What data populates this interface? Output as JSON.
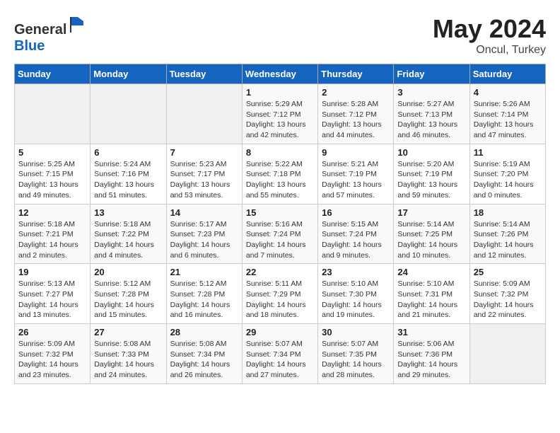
{
  "header": {
    "logo_general": "General",
    "logo_blue": "Blue",
    "month_year": "May 2024",
    "location": "Oncul, Turkey"
  },
  "weekdays": [
    "Sunday",
    "Monday",
    "Tuesday",
    "Wednesday",
    "Thursday",
    "Friday",
    "Saturday"
  ],
  "weeks": [
    [
      {
        "day": "",
        "info": ""
      },
      {
        "day": "",
        "info": ""
      },
      {
        "day": "",
        "info": ""
      },
      {
        "day": "1",
        "info": "Sunrise: 5:29 AM\nSunset: 7:12 PM\nDaylight: 13 hours\nand 42 minutes."
      },
      {
        "day": "2",
        "info": "Sunrise: 5:28 AM\nSunset: 7:12 PM\nDaylight: 13 hours\nand 44 minutes."
      },
      {
        "day": "3",
        "info": "Sunrise: 5:27 AM\nSunset: 7:13 PM\nDaylight: 13 hours\nand 46 minutes."
      },
      {
        "day": "4",
        "info": "Sunrise: 5:26 AM\nSunset: 7:14 PM\nDaylight: 13 hours\nand 47 minutes."
      }
    ],
    [
      {
        "day": "5",
        "info": "Sunrise: 5:25 AM\nSunset: 7:15 PM\nDaylight: 13 hours\nand 49 minutes."
      },
      {
        "day": "6",
        "info": "Sunrise: 5:24 AM\nSunset: 7:16 PM\nDaylight: 13 hours\nand 51 minutes."
      },
      {
        "day": "7",
        "info": "Sunrise: 5:23 AM\nSunset: 7:17 PM\nDaylight: 13 hours\nand 53 minutes."
      },
      {
        "day": "8",
        "info": "Sunrise: 5:22 AM\nSunset: 7:18 PM\nDaylight: 13 hours\nand 55 minutes."
      },
      {
        "day": "9",
        "info": "Sunrise: 5:21 AM\nSunset: 7:19 PM\nDaylight: 13 hours\nand 57 minutes."
      },
      {
        "day": "10",
        "info": "Sunrise: 5:20 AM\nSunset: 7:19 PM\nDaylight: 13 hours\nand 59 minutes."
      },
      {
        "day": "11",
        "info": "Sunrise: 5:19 AM\nSunset: 7:20 PM\nDaylight: 14 hours\nand 0 minutes."
      }
    ],
    [
      {
        "day": "12",
        "info": "Sunrise: 5:18 AM\nSunset: 7:21 PM\nDaylight: 14 hours\nand 2 minutes."
      },
      {
        "day": "13",
        "info": "Sunrise: 5:18 AM\nSunset: 7:22 PM\nDaylight: 14 hours\nand 4 minutes."
      },
      {
        "day": "14",
        "info": "Sunrise: 5:17 AM\nSunset: 7:23 PM\nDaylight: 14 hours\nand 6 minutes."
      },
      {
        "day": "15",
        "info": "Sunrise: 5:16 AM\nSunset: 7:24 PM\nDaylight: 14 hours\nand 7 minutes."
      },
      {
        "day": "16",
        "info": "Sunrise: 5:15 AM\nSunset: 7:24 PM\nDaylight: 14 hours\nand 9 minutes."
      },
      {
        "day": "17",
        "info": "Sunrise: 5:14 AM\nSunset: 7:25 PM\nDaylight: 14 hours\nand 10 minutes."
      },
      {
        "day": "18",
        "info": "Sunrise: 5:14 AM\nSunset: 7:26 PM\nDaylight: 14 hours\nand 12 minutes."
      }
    ],
    [
      {
        "day": "19",
        "info": "Sunrise: 5:13 AM\nSunset: 7:27 PM\nDaylight: 14 hours\nand 13 minutes."
      },
      {
        "day": "20",
        "info": "Sunrise: 5:12 AM\nSunset: 7:28 PM\nDaylight: 14 hours\nand 15 minutes."
      },
      {
        "day": "21",
        "info": "Sunrise: 5:12 AM\nSunset: 7:28 PM\nDaylight: 14 hours\nand 16 minutes."
      },
      {
        "day": "22",
        "info": "Sunrise: 5:11 AM\nSunset: 7:29 PM\nDaylight: 14 hours\nand 18 minutes."
      },
      {
        "day": "23",
        "info": "Sunrise: 5:10 AM\nSunset: 7:30 PM\nDaylight: 14 hours\nand 19 minutes."
      },
      {
        "day": "24",
        "info": "Sunrise: 5:10 AM\nSunset: 7:31 PM\nDaylight: 14 hours\nand 21 minutes."
      },
      {
        "day": "25",
        "info": "Sunrise: 5:09 AM\nSunset: 7:32 PM\nDaylight: 14 hours\nand 22 minutes."
      }
    ],
    [
      {
        "day": "26",
        "info": "Sunrise: 5:09 AM\nSunset: 7:32 PM\nDaylight: 14 hours\nand 23 minutes."
      },
      {
        "day": "27",
        "info": "Sunrise: 5:08 AM\nSunset: 7:33 PM\nDaylight: 14 hours\nand 24 minutes."
      },
      {
        "day": "28",
        "info": "Sunrise: 5:08 AM\nSunset: 7:34 PM\nDaylight: 14 hours\nand 26 minutes."
      },
      {
        "day": "29",
        "info": "Sunrise: 5:07 AM\nSunset: 7:34 PM\nDaylight: 14 hours\nand 27 minutes."
      },
      {
        "day": "30",
        "info": "Sunrise: 5:07 AM\nSunset: 7:35 PM\nDaylight: 14 hours\nand 28 minutes."
      },
      {
        "day": "31",
        "info": "Sunrise: 5:06 AM\nSunset: 7:36 PM\nDaylight: 14 hours\nand 29 minutes."
      },
      {
        "day": "",
        "info": ""
      }
    ]
  ]
}
